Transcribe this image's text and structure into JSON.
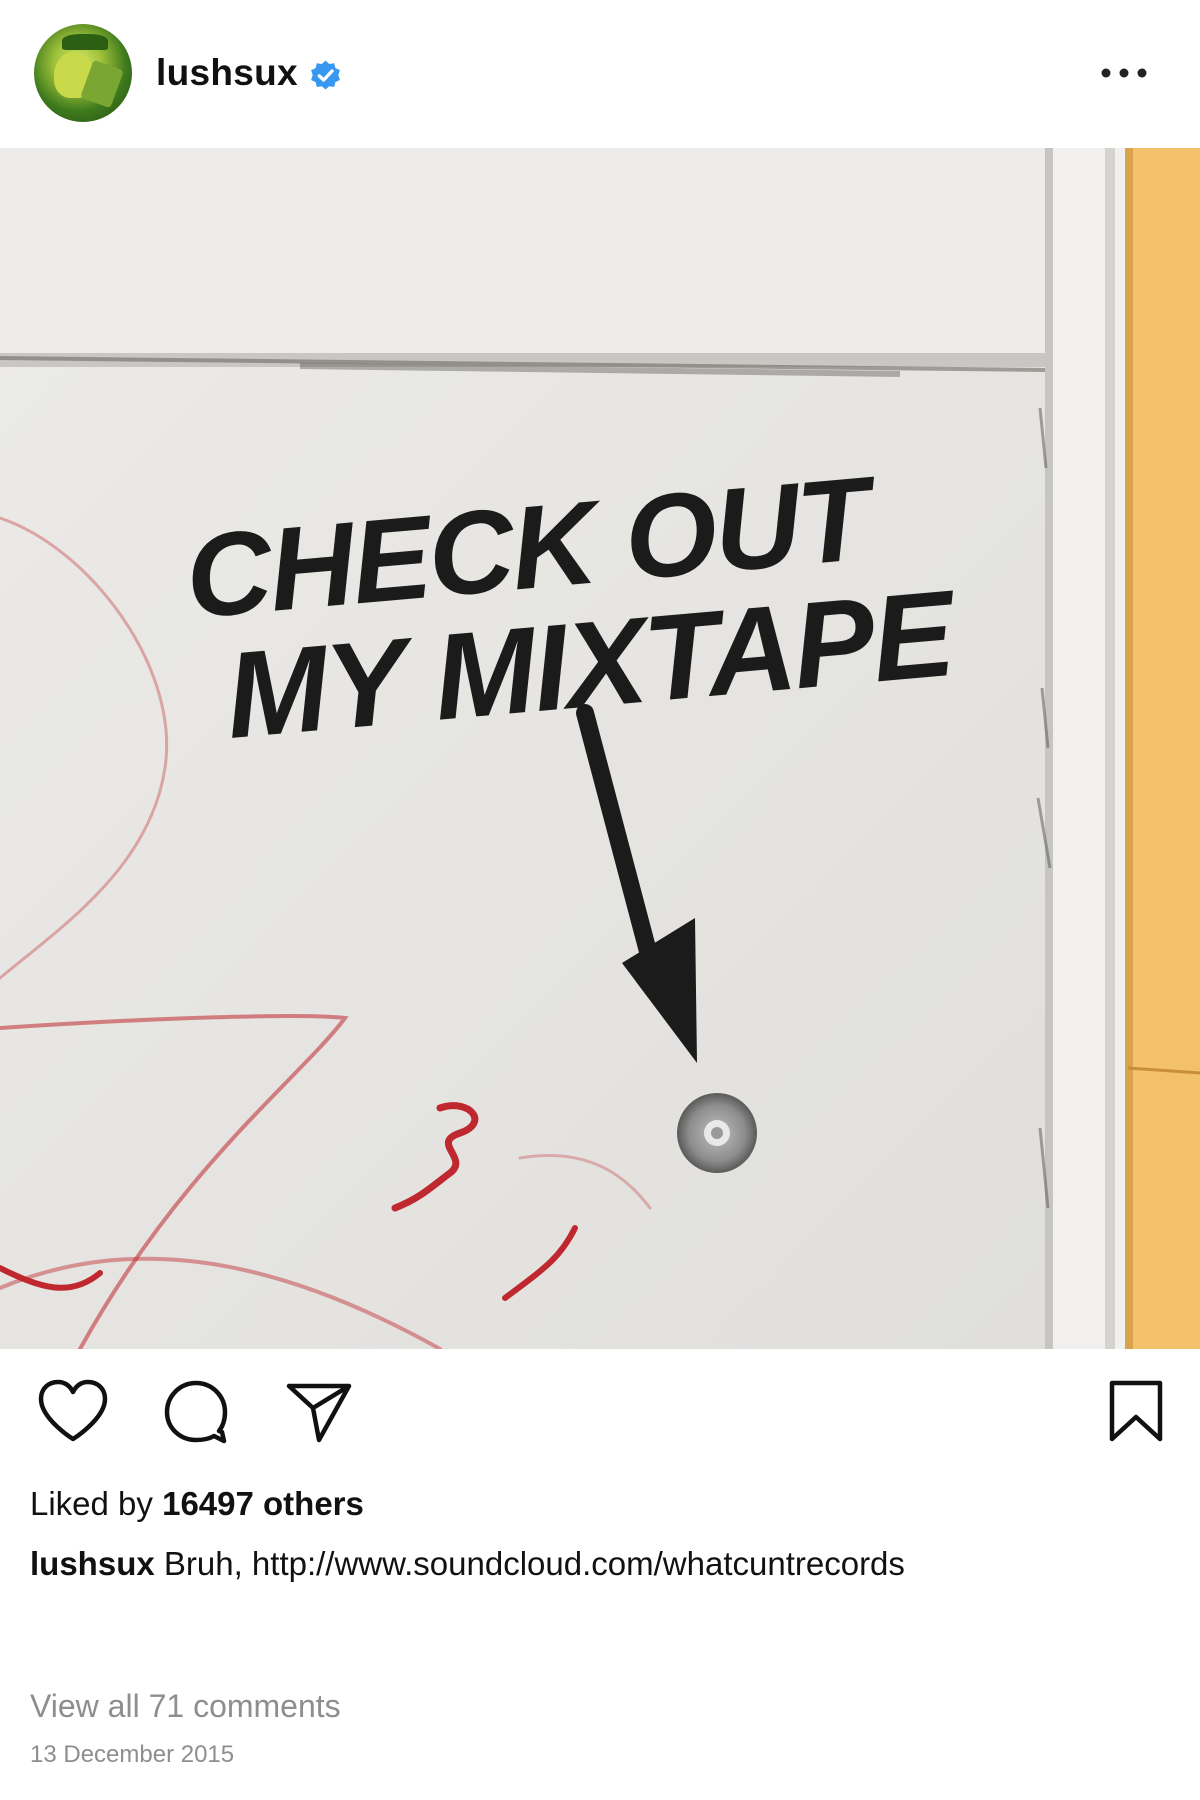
{
  "post": {
    "username": "lushsux",
    "verified": true,
    "image": {
      "graffiti_line_1": "CHECK OUT",
      "graffiti_line_2": "MY MIXTAPE"
    },
    "likes": {
      "prefix": "Liked by",
      "count_text": "16497 others"
    },
    "caption": {
      "username": "lushsux",
      "text": "Bruh, http://www.soundcloud.com/whatcuntrecords"
    },
    "comments_link": "View all 71 comments",
    "date": "13 December 2015"
  },
  "icons": {
    "header": [
      "avatar",
      "verified-badge-icon",
      "more-options-icon"
    ],
    "actions": [
      "heart-icon",
      "comment-icon",
      "share-icon",
      "bookmark-icon"
    ]
  },
  "colors": {
    "verified": "#3897f0",
    "muted_text": "#8e8e8e",
    "text": "#111111",
    "wall": "#e8e7e4",
    "yellow_pillar": "#f3c16a",
    "graffiti_red": "#c0282f"
  }
}
